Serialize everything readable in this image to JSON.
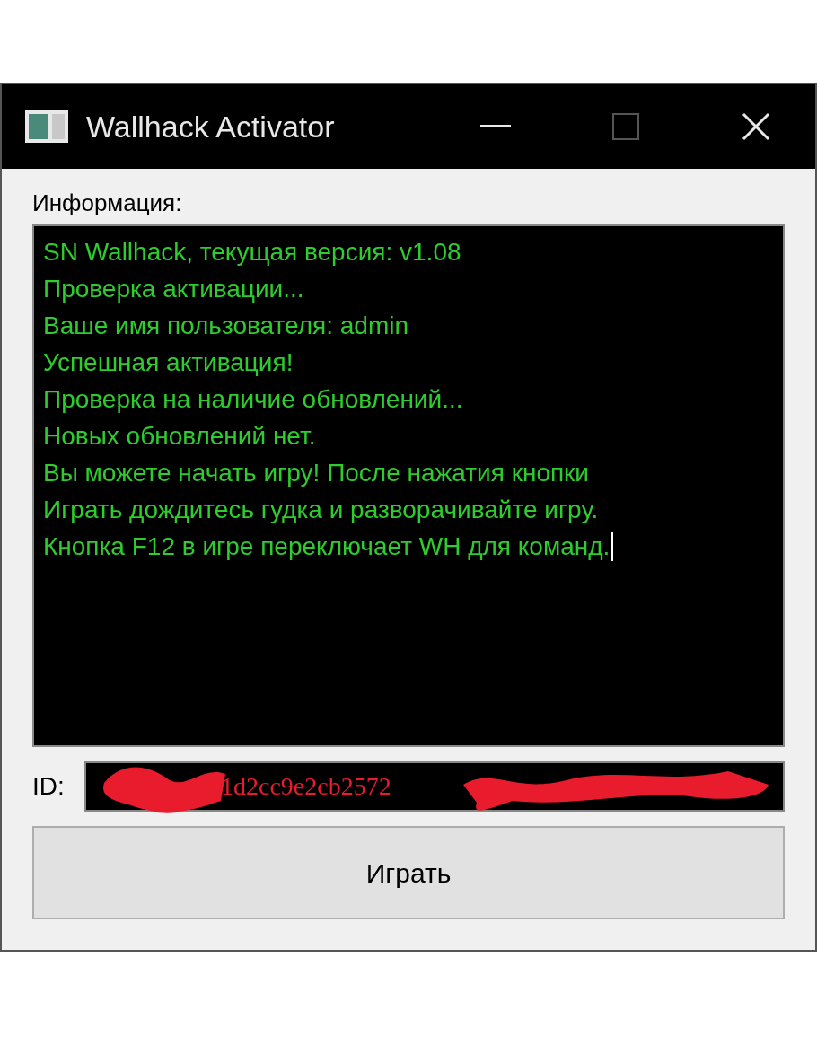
{
  "window": {
    "title": "Wallhack Activator",
    "maximize_disabled": true
  },
  "info_label": "Информация:",
  "console_lines": [
    "SN Wallhack, текущая версия: v1.08",
    "Проверка активации...",
    "Ваше имя пользователя: admin",
    "Успешная активация!",
    "Проверка на наличие обновлений...",
    "Новых обновлений нет.",
    "Вы можете начать игру! После нажатия кнопки",
    "Играть дождитесь гудка и разворачивайте игру.",
    "Кнопка F12 в игре переключает WH для команд."
  ],
  "id_field": {
    "label": "ID:",
    "value": "1d2cc9e2cb2572"
  },
  "buttons": [
    "Играть"
  ]
}
